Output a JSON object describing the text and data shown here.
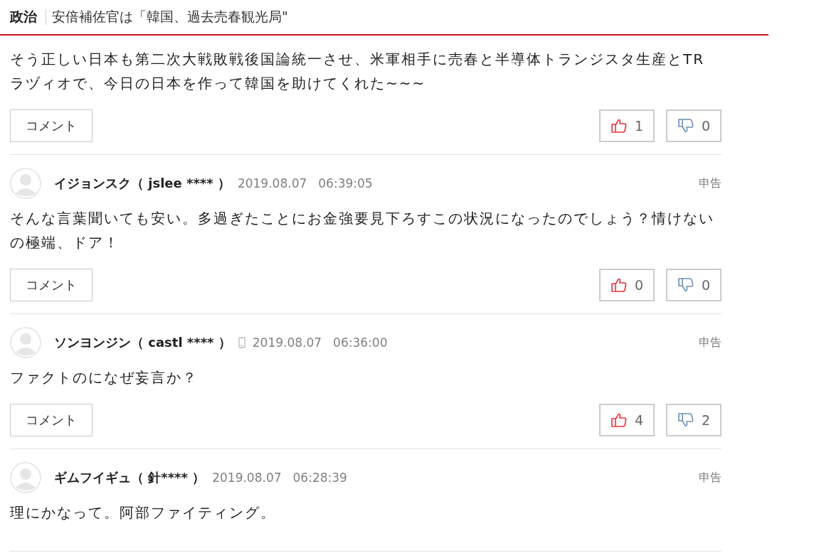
{
  "header": {
    "category": "政治",
    "title": "安倍補佐官は「韓国、過去売春観光局\""
  },
  "comments": [
    {
      "text": "そう正しい日本も第二次大戦敗戦後国論統一させ、米軍相手に売春と半導体トランジスタ生産とTRラヅィオで、今日の日本を作って韓国を助けてくれた~~~",
      "reply_button": "コメント",
      "likes": "1",
      "dislikes": "0"
    },
    {
      "author": "イジョンスク（ jslee **** ）",
      "mobile": false,
      "date": "2019.08.07",
      "time": "06:39:05",
      "report": "申告",
      "text": "そんな言葉聞いても安い。多過ぎたことにお金強要見下ろすこの状況になったのでしょう？情けないの極端、ドア！",
      "reply_button": "コメント",
      "likes": "0",
      "dislikes": "0"
    },
    {
      "author": "ソンヨンジン（ castl **** ）",
      "mobile": true,
      "date": "2019.08.07",
      "time": "06:36:00",
      "report": "申告",
      "text": "ファクトのになぜ妄言か？",
      "reply_button": "コメント",
      "likes": "4",
      "dislikes": "2"
    },
    {
      "author": "ギムフイギュ（ 針**** ）",
      "mobile": false,
      "date": "2019.08.07",
      "time": "06:28:39",
      "report": "申告",
      "text": "理にかなって。阿部ファイティング。"
    }
  ]
}
